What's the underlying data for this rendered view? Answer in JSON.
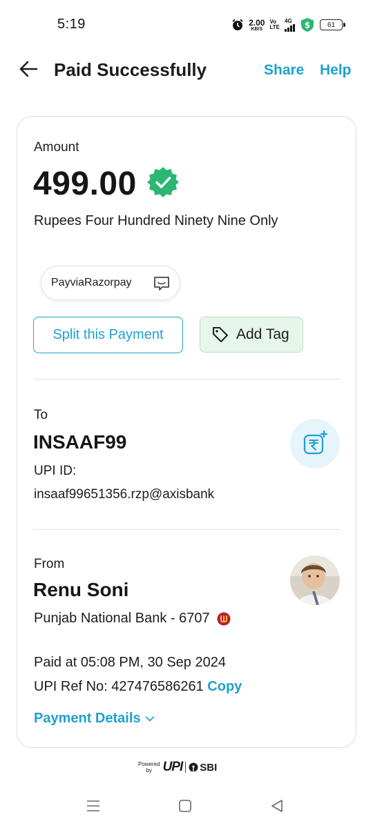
{
  "status_bar": {
    "time": "5:19",
    "net_speed": "2.00",
    "net_unit": "KB/S",
    "volte_top": "Vo",
    "volte_bottom": "LTE",
    "signal_type": "4G",
    "battery": "61"
  },
  "header": {
    "title": "Paid Successfully",
    "share": "Share",
    "help": "Help"
  },
  "amount": {
    "label": "Amount",
    "value": "499.00",
    "words": "Rupees Four Hundred Ninety Nine Only"
  },
  "note": "PayviaRazorpay",
  "actions": {
    "split": "Split this Payment",
    "tag": "Add Tag"
  },
  "to": {
    "label": "To",
    "name": "INSAAF99",
    "upi_label": "UPI ID:",
    "upi_id": "insaaf99651356.rzp@axisbank"
  },
  "from": {
    "label": "From",
    "name": "Renu Soni",
    "bank": "Punjab National Bank - 6707"
  },
  "details": {
    "paid_at": "Paid at 05:08 PM, 30 Sep 2024",
    "ref_prefix": "UPI Ref No: 427476586261",
    "copy": "Copy",
    "payment_details": "Payment Details"
  },
  "footer": {
    "powered": "Powered",
    "by": "by",
    "upi": "UPI",
    "sbi": "SBI"
  },
  "colors": {
    "accent": "#1da1d0",
    "success": "#2bb673",
    "tag_bg": "#e6f6ea"
  }
}
